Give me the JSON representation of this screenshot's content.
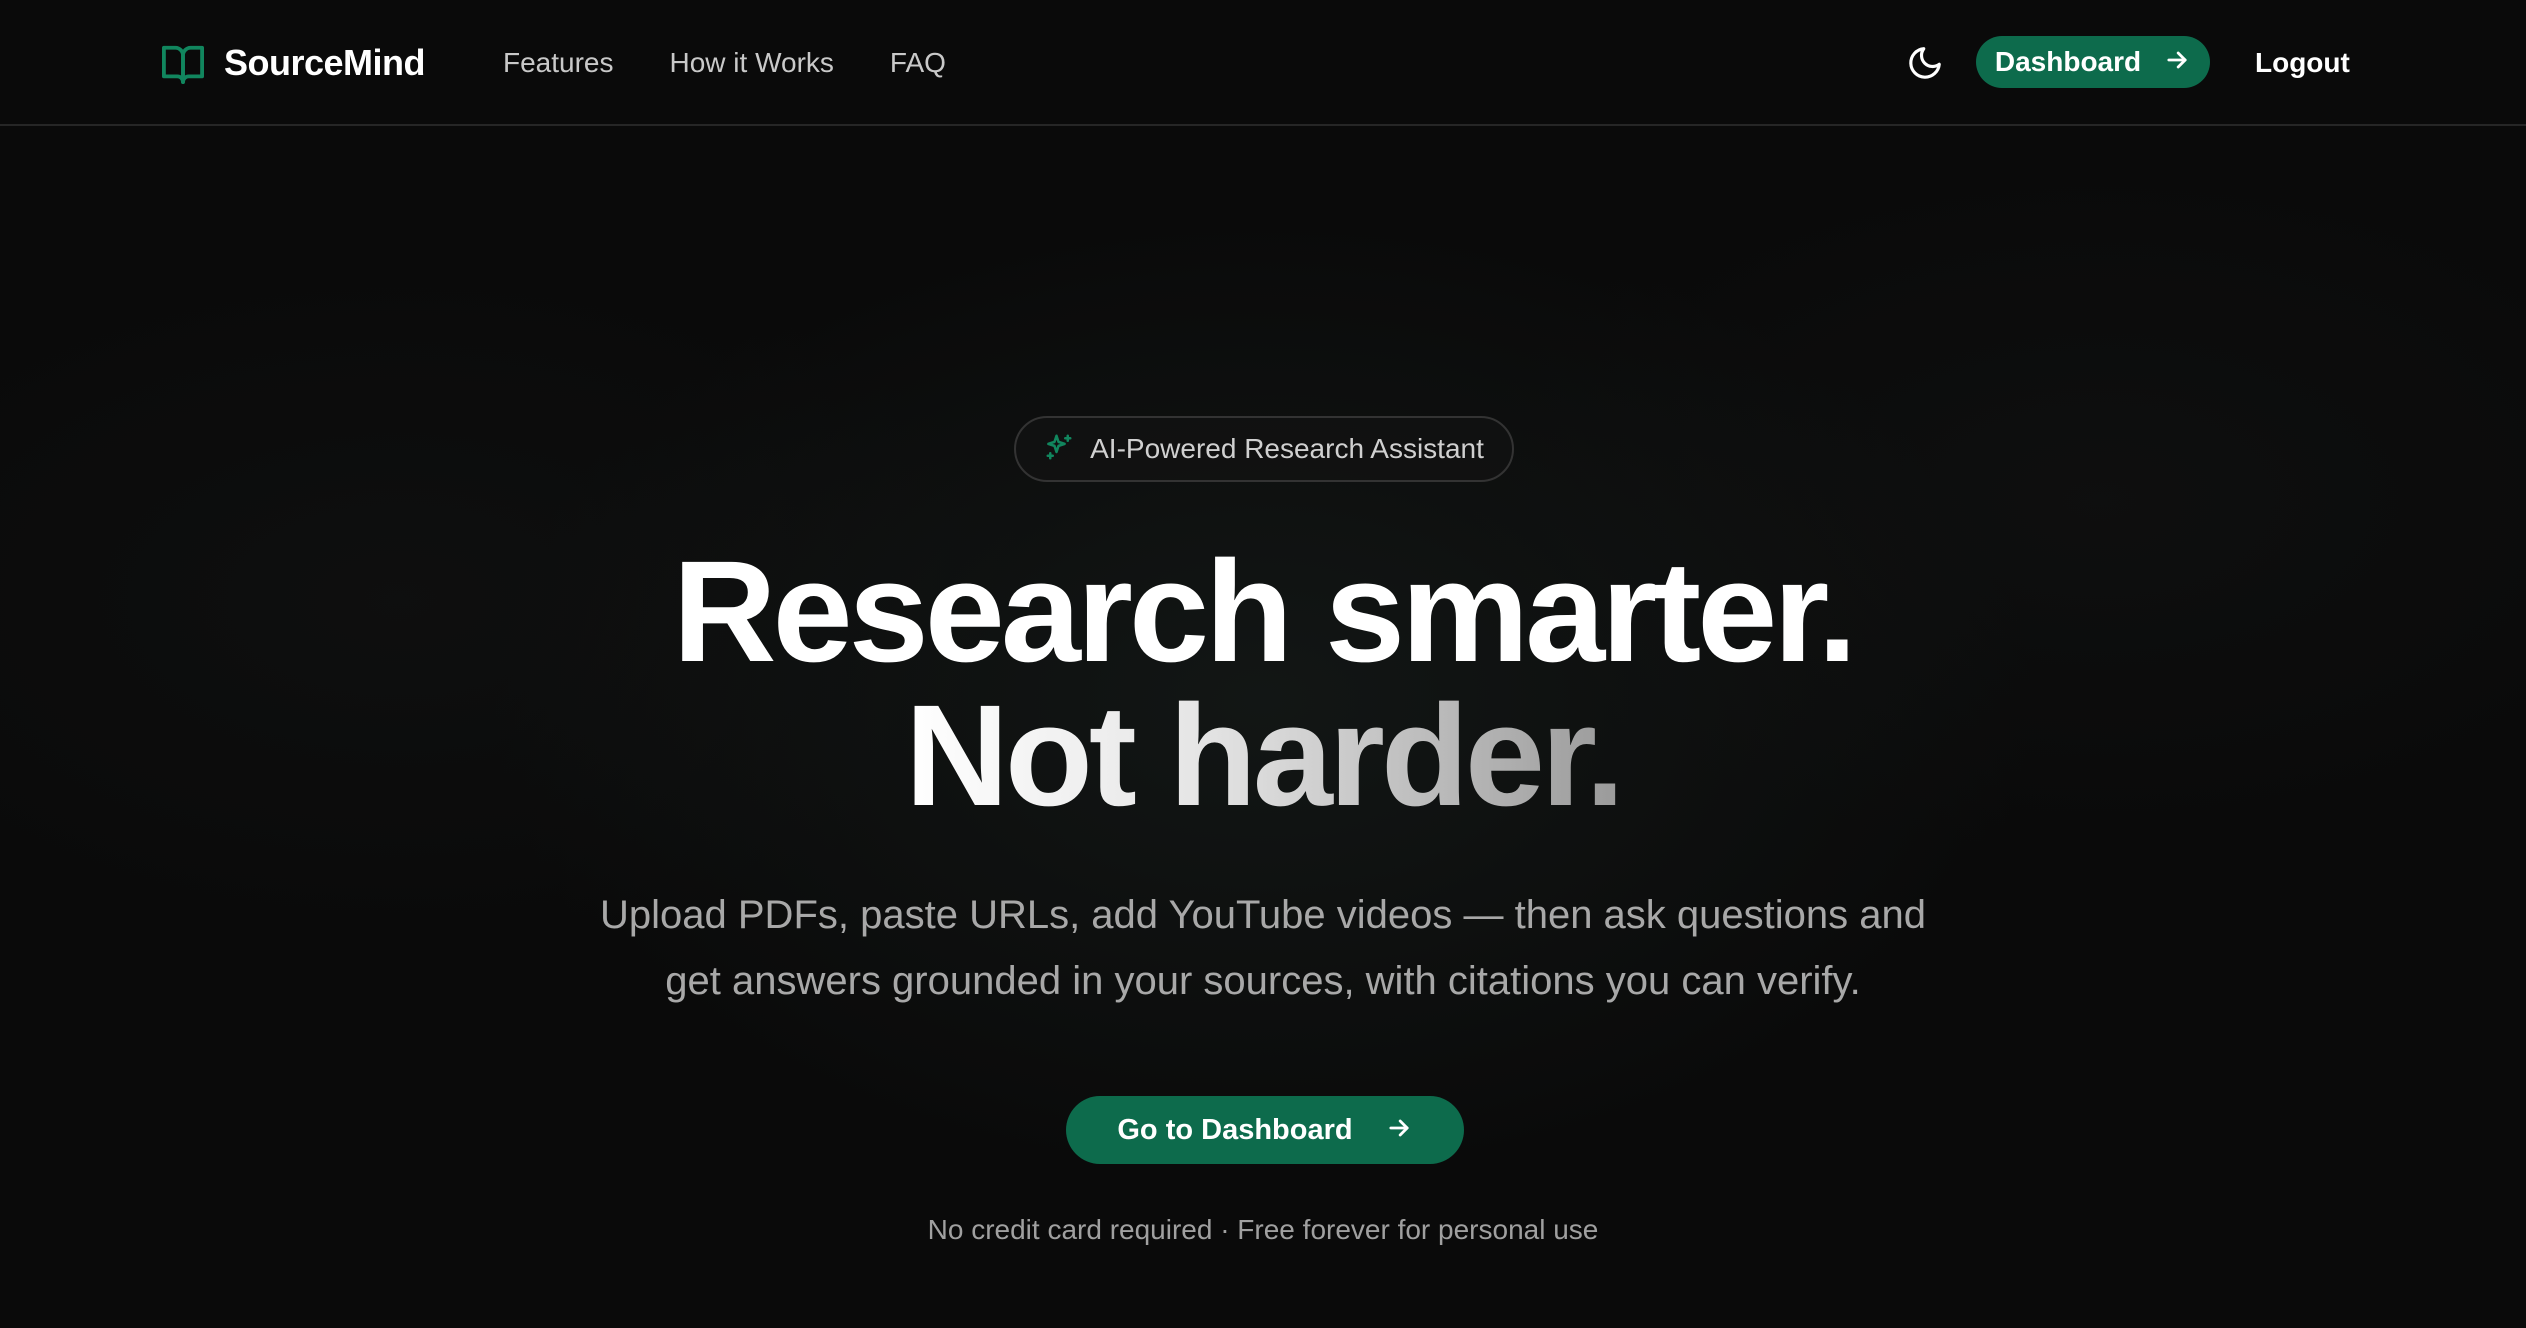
{
  "nav": {
    "brand": "SourceMind",
    "links": [
      "Features",
      "How it Works",
      "FAQ"
    ],
    "dashboard_label": "Dashboard",
    "logout_label": "Logout"
  },
  "hero": {
    "badge": "AI-Powered Research Assistant",
    "headline_line1": "Research smarter.",
    "headline_line2": "Not harder.",
    "subtitle_line1": "Upload PDFs, paste URLs, add YouTube videos — then ask questions and",
    "subtitle_line2": "get answers grounded in your sources, with citations you can verify.",
    "cta_label": "Go to Dashboard",
    "footnote": "No credit card required · Free forever for personal use"
  },
  "icons": {
    "brand": "book-open-icon",
    "theme": "moon-icon",
    "badge": "sparkles-icon",
    "arrow": "arrow-right-icon"
  },
  "colors": {
    "background": "#0a0a0a",
    "accent": "#0d6b4c",
    "accent_icon": "#11865e",
    "text_primary": "#ffffff",
    "text_muted": "#a8a8a8"
  }
}
